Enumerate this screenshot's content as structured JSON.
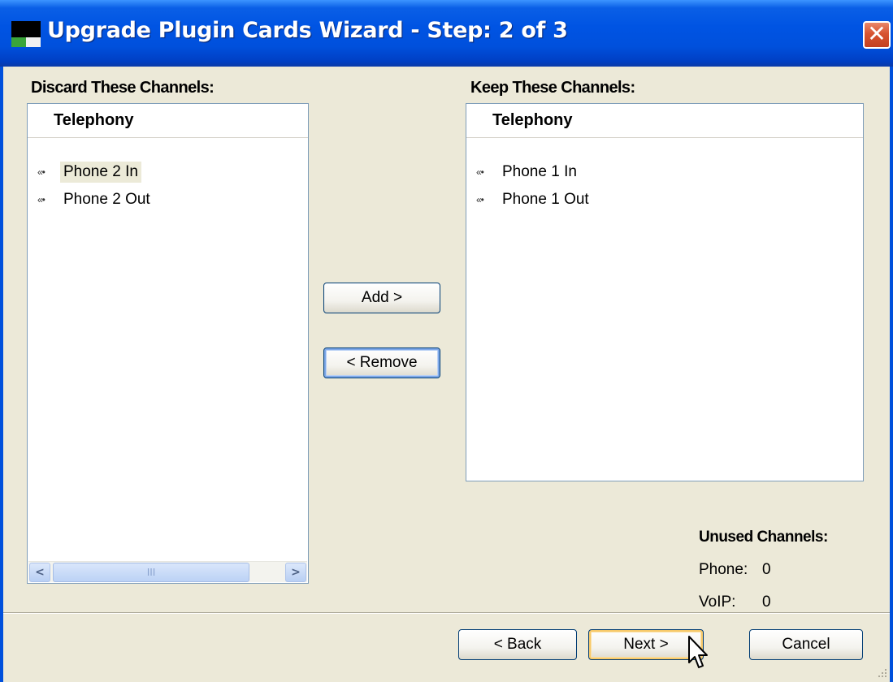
{
  "window": {
    "title": "Upgrade Plugin Cards Wizard - Step: 2 of 3",
    "close_glyph": "✕"
  },
  "left_panel": {
    "label": "Discard These Channels:",
    "header": "Telephony",
    "items": [
      {
        "icon": "«•",
        "label": "Phone 2 In",
        "selected": true
      },
      {
        "icon": "«•",
        "label": "Phone 2 Out",
        "selected": false
      }
    ],
    "scroll_left": "<",
    "scroll_right": ">",
    "scroll_thumb_grip": "III"
  },
  "right_panel": {
    "label": "Keep These Channels:",
    "header": "Telephony",
    "items": [
      {
        "icon": "«•",
        "label": "Phone 1 In"
      },
      {
        "icon": "«•",
        "label": "Phone 1 Out"
      }
    ]
  },
  "actions": {
    "add_label": "Add >",
    "remove_label": "< Remove"
  },
  "unused": {
    "title": "Unused Channels:",
    "phone_label": "Phone:",
    "phone_value": "0",
    "voip_label": "VoIP:",
    "voip_value": "0"
  },
  "footer": {
    "back_label": "< Back",
    "next_label": "Next >",
    "cancel_label": "Cancel"
  }
}
